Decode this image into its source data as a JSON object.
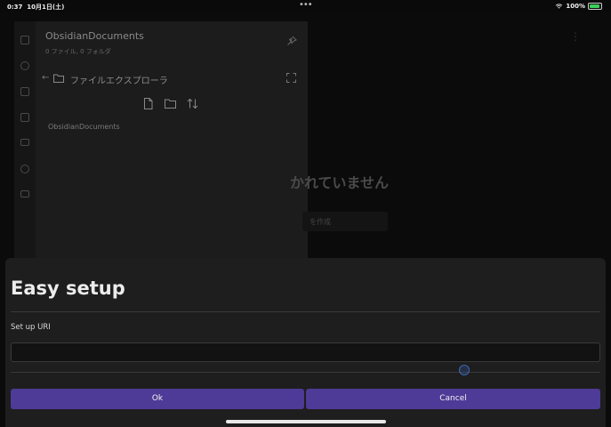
{
  "status_bar": {
    "time": "0:37",
    "date": "10月1日(土)",
    "dots": "•••",
    "battery_text": "100%",
    "battery_color": "#3bd15a"
  },
  "sidebar": {
    "vault_name": "ObsidianDocuments",
    "counts": "0 ファイル, 0 フォルダ",
    "file_explorer_title": "ファイルエクスプローラ",
    "tree_items": [
      "ObsidianDocuments"
    ]
  },
  "main": {
    "empty_message": "かれていません",
    "empty_button": "を作成",
    "more": "⋮"
  },
  "modal": {
    "title": "Easy setup",
    "field_label": "Set up URI",
    "uri_value": "",
    "ok_label": "Ok",
    "cancel_label": "Cancel",
    "button_color": "#4e3a97"
  },
  "icons": [
    "wifi-icon",
    "battery-icon",
    "pin-icon",
    "back-arrow-icon",
    "folder-icon",
    "expand-icon",
    "new-file-icon",
    "new-folder-icon",
    "sort-icon",
    "files-icon",
    "graph-icon",
    "calendar-icon",
    "copy-icon",
    "cards-icon",
    "plugin-icon",
    "archive-icon"
  ]
}
